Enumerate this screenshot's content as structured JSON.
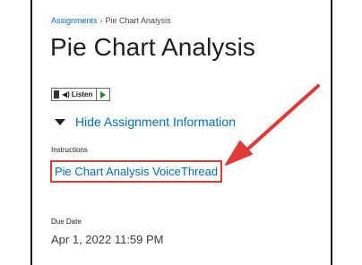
{
  "breadcrumb": {
    "parent": "Assignments",
    "separator": "›",
    "current": "Pie Chart Analysis"
  },
  "page": {
    "title": "Pie Chart Analysis"
  },
  "listen": {
    "label": "Listen",
    "speaker_icon": "speaker-icon",
    "play_icon": "play-icon"
  },
  "assignment_info": {
    "toggle_label": "Hide Assignment Information",
    "toggle_icon": "caret-down-icon"
  },
  "instructions": {
    "label": "Instructions",
    "link_text": "Pie Chart Analysis VoiceThread"
  },
  "due": {
    "label": "Due Date",
    "value": "Apr 1, 2022 11:59 PM"
  },
  "colors": {
    "link": "#006fbf",
    "highlight": "#e03a37",
    "play": "#1f8b2c",
    "text": "#202122"
  }
}
